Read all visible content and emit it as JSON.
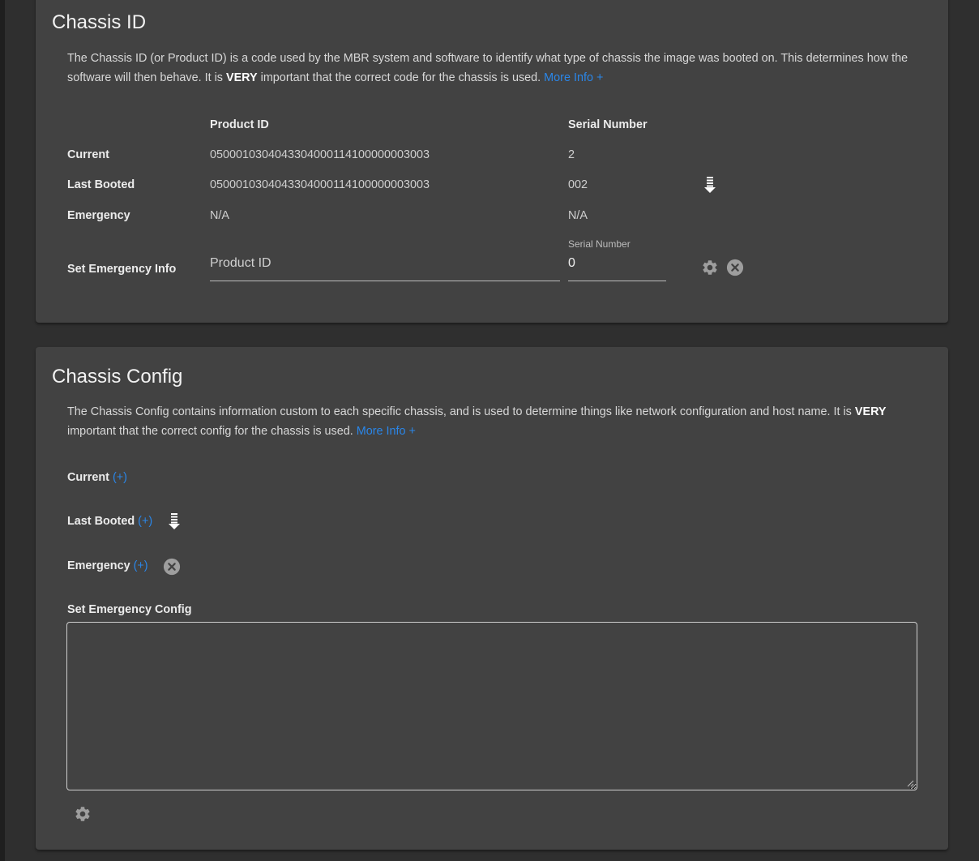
{
  "chassis_id": {
    "title": "Chassis ID",
    "desc_part1": "The Chassis ID (or Product ID) is a code used by the MBR system and software to identify what type of chassis the image was booted on. This determines how the software will then behave. It is ",
    "desc_bold": "VERY",
    "desc_part2": " important that the correct code for the chassis is used. ",
    "more_info": "More Info +",
    "col_product_id": "Product ID",
    "col_serial": "Serial Number",
    "rows": [
      {
        "label": "Current",
        "product_id": "0500010304043304000114100000003003",
        "serial": "2"
      },
      {
        "label": "Last Booted",
        "product_id": "0500010304043304000114100000003003",
        "serial": "002"
      },
      {
        "label": "Emergency",
        "product_id": "N/A",
        "serial": "N/A"
      }
    ],
    "set_label": "Set Emergency Info",
    "product_placeholder": "Product ID",
    "serial_field_label": "Serial Number",
    "serial_value": "0"
  },
  "chassis_config": {
    "title": "Chassis Config",
    "desc_part1": "The Chassis Config contains information custom to each specific chassis, and is used to determine things like network configuration and host name. It is ",
    "desc_bold": "VERY",
    "desc_part2": " important that the correct config for the chassis is used. ",
    "more_info": "More Info +",
    "current_label": "Current",
    "last_booted_label": "Last Booted",
    "emergency_label": "Emergency",
    "expand_label": "(+)",
    "set_label": "Set Emergency Config",
    "textarea_value": ""
  },
  "icons": {
    "download": "download-list-icon",
    "gear": "gear-icon",
    "clear": "close-circle-icon"
  },
  "colors": {
    "background": "#2f2f2f",
    "card": "#424242",
    "link": "#2a86e8",
    "icon": "#9e9e9e"
  }
}
